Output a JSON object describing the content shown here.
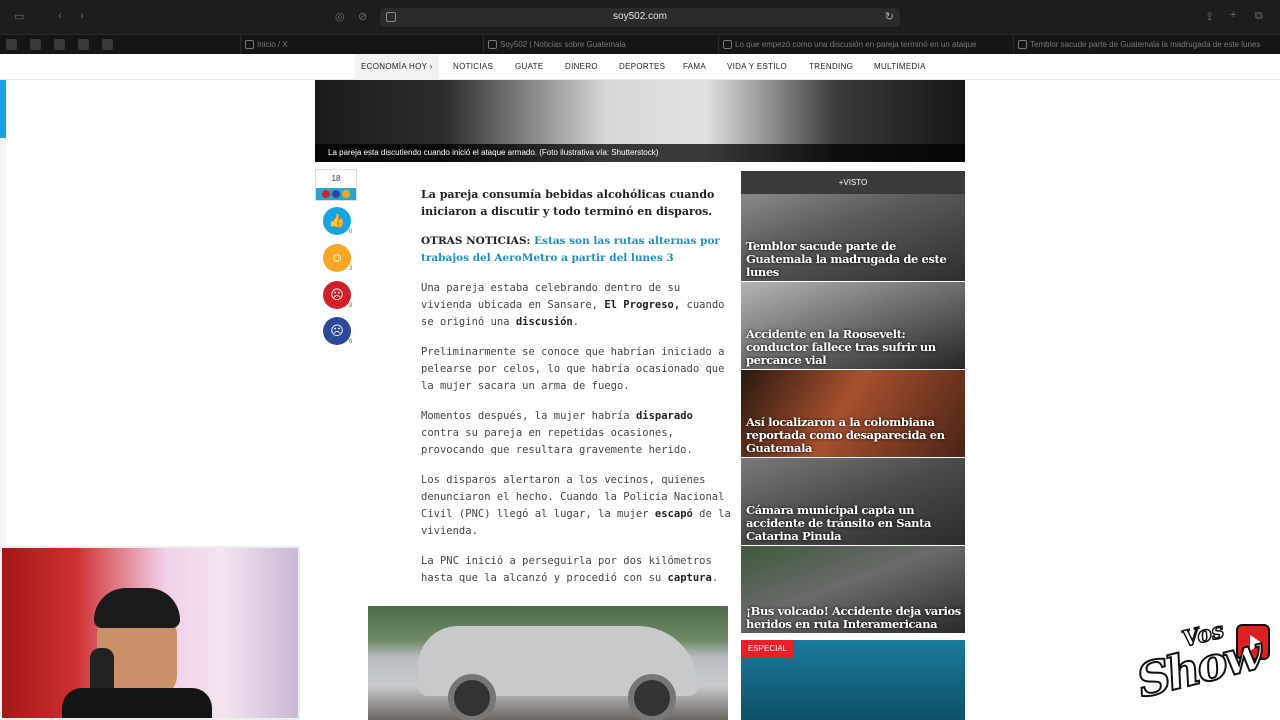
{
  "browser": {
    "url": "soy502.com",
    "tabs": [
      "Inicio / X",
      "Soy502 | Noticias sobre Guatemala",
      "Lo que empezó como una discusión en pareja terminó en un ataque",
      "Temblor sacude parte de Guatemala la madrugada de este lunes"
    ]
  },
  "nav": {
    "items": [
      "ECONOMÍA HOY ›",
      "NOTICIAS",
      "GUATE",
      "DINERO",
      "DEPORTES",
      "FAMA",
      "VIDA Y ESTILO",
      "TRENDING",
      "MULTIMEDIA"
    ]
  },
  "hero": {
    "caption": "La pareja esta discutiendo cuando inició el ataque armado. (Foto ilustrativa vía: Shutterstock)"
  },
  "reactions": {
    "total": "18",
    "items": [
      {
        "icon": "thumbs-up-icon",
        "count": "0",
        "color": "#1aa3e0"
      },
      {
        "icon": "laugh-icon",
        "count": "3",
        "color": "#f5a623"
      },
      {
        "icon": "angry-icon",
        "count": "9",
        "color": "#d0202a"
      },
      {
        "icon": "sad-icon",
        "count": "6",
        "color": "#2d4a9a"
      }
    ]
  },
  "article": {
    "lead": "La pareja consumía bebidas alcohólicas cuando iniciaron a discutir y todo terminó en disparos.",
    "otras_label": "OTRAS NOTICIAS:",
    "otras_link": "Estas son las rutas alternas por trabajos del AeroMetro a partir del lunes 3",
    "p1a": "Una pareja estaba celebrando dentro de su vivienda ubicada en Sansare,",
    "p1b": "El Progreso,",
    "p1c": "cuando se originó una",
    "p1d": "discusión",
    "p1e": ".",
    "p2": "Preliminarmente se conoce que habrían iniciado a pelearse por celos, lo que habría ocasionado que la mujer sacara un arma de fuego.",
    "p3a": "Momentos después, la mujer habría",
    "p3b": "disparado",
    "p3c": "contra su pareja en repetidas ocasiones, provocando que resultara gravemente herido.",
    "p4a": "Los disparos alertaron a los vecinos, quienes denunciaron el hecho. Cuando la Policía Nacional Civil (PNC) llegó al lugar, la mujer",
    "p4b": "escapó",
    "p4c": "de la vivienda.",
    "p5a": "La PNC inició a perseguirla por dos kilómetros hasta que la alcanzó y procedió con su",
    "p5b": "captura",
    "p5c": "."
  },
  "sidebar": {
    "header": "+VISTO",
    "items": [
      {
        "title": "Temblor sacude parte de Guatemala la madrugada de este lunes"
      },
      {
        "title": "Accidente en la Roosevelt: conductor fallece tras sufrir un percance vial"
      },
      {
        "title": "Así localizaron a la colombiana reportada como desaparecida en Guatemala"
      },
      {
        "title": "Cámara municipal capta un accidente de tránsito en Santa Catarina Pinula"
      },
      {
        "title": "¡Bus volcado! Accidente deja varios heridos en ruta Interamericana"
      }
    ],
    "badge": "ESPECIAL"
  },
  "overlay": {
    "logo_small": "Vos",
    "logo_big": "Show"
  }
}
